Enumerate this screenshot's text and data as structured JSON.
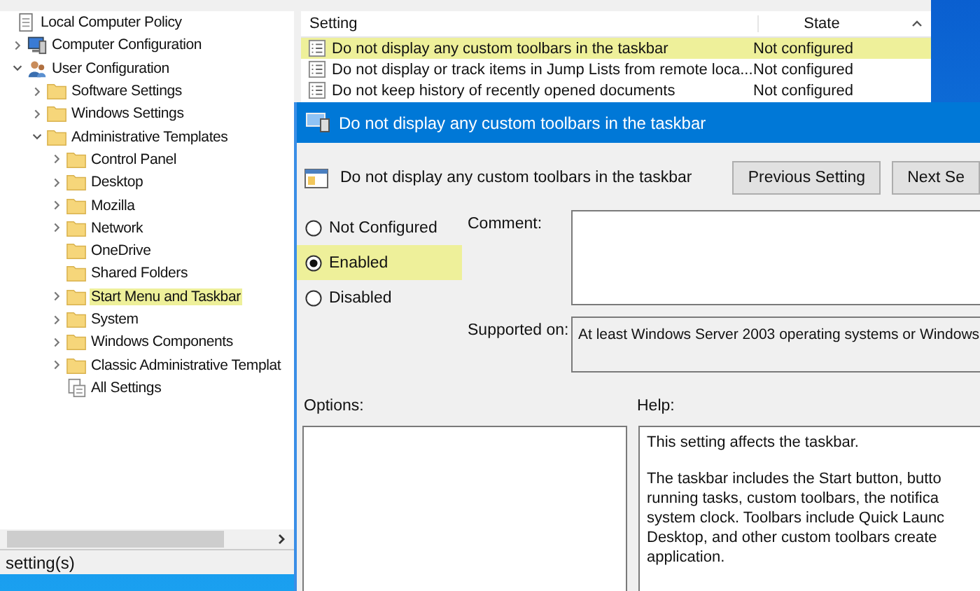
{
  "tree": {
    "items": [
      {
        "label": "Local Computer Policy",
        "kind": "policy",
        "selected": false,
        "children": [
          {
            "label": "Computer Configuration",
            "kind": "computer",
            "expandable": true,
            "expanded": false,
            "selected": false
          },
          {
            "label": "User Configuration",
            "kind": "user",
            "expandable": true,
            "expanded": true,
            "selected": false,
            "children": [
              {
                "label": "Software Settings",
                "kind": "folder",
                "expandable": true,
                "expanded": false,
                "selected": false
              },
              {
                "label": "Windows Settings",
                "kind": "folder",
                "expandable": true,
                "expanded": false,
                "selected": false
              },
              {
                "label": "Administrative Templates",
                "kind": "folder",
                "expandable": true,
                "expanded": true,
                "selected": false,
                "children": [
                  {
                    "label": "Control Panel",
                    "kind": "folder",
                    "expandable": true,
                    "expanded": false,
                    "selected": false
                  },
                  {
                    "label": "Desktop",
                    "kind": "folder",
                    "expandable": true,
                    "expanded": false,
                    "selected": false
                  },
                  {
                    "label": "Mozilla",
                    "kind": "folder",
                    "expandable": true,
                    "expanded": false,
                    "selected": false
                  },
                  {
                    "label": "Network",
                    "kind": "folder",
                    "expandable": true,
                    "expanded": false,
                    "selected": false
                  },
                  {
                    "label": "OneDrive",
                    "kind": "folder",
                    "expandable": false,
                    "expanded": false,
                    "selected": false
                  },
                  {
                    "label": "Shared Folders",
                    "kind": "folder",
                    "expandable": false,
                    "expanded": false,
                    "selected": false
                  },
                  {
                    "label": "Start Menu and Taskbar",
                    "kind": "folder",
                    "expandable": true,
                    "expanded": false,
                    "selected": true
                  },
                  {
                    "label": "System",
                    "kind": "folder",
                    "expandable": true,
                    "expanded": false,
                    "selected": false
                  },
                  {
                    "label": "Windows Components",
                    "kind": "folder",
                    "expandable": true,
                    "expanded": false,
                    "selected": false
                  },
                  {
                    "label": "Classic Administrative Templat",
                    "kind": "folder",
                    "expandable": true,
                    "expanded": false,
                    "selected": false
                  },
                  {
                    "label": "All Settings",
                    "kind": "all-settings",
                    "expandable": false,
                    "expanded": false,
                    "selected": false
                  }
                ]
              }
            ]
          }
        ]
      }
    ]
  },
  "status_bar": {
    "text": "setting(s)"
  },
  "list": {
    "columns": [
      "Setting",
      "State"
    ],
    "rows": [
      {
        "setting": "Do not display any custom toolbars in the taskbar",
        "state": "Not configured",
        "selected": true
      },
      {
        "setting": "Do not display or track items in Jump Lists from remote loca...",
        "state": "Not configured",
        "selected": false
      },
      {
        "setting": "Do not keep history of recently opened documents",
        "state": "Not configured",
        "selected": false
      }
    ]
  },
  "dialog": {
    "title": "Do not display any custom toolbars in the taskbar",
    "header_title": "Do not display any custom toolbars in the taskbar",
    "buttons": [
      "Previous Setting",
      "Next Se"
    ],
    "radios": [
      {
        "label": "Not Configured",
        "selected": false,
        "highlighted": false
      },
      {
        "label": "Enabled",
        "selected": true,
        "highlighted": true
      },
      {
        "label": "Disabled",
        "selected": false,
        "highlighted": false
      }
    ],
    "comment_label": "Comment:",
    "supported_label": "Supported on:",
    "supported_text": "At least Windows Server 2003 operating systems or Windows",
    "options_label": "Options:",
    "help_label": "Help:",
    "help_paragraphs": [
      [
        "This setting affects the taskbar."
      ],
      [
        "The taskbar includes the Start button, butto",
        "running tasks, custom toolbars, the notifica",
        "system clock. Toolbars include Quick Launc",
        "Desktop, and other custom toolbars create",
        "application."
      ]
    ]
  }
}
